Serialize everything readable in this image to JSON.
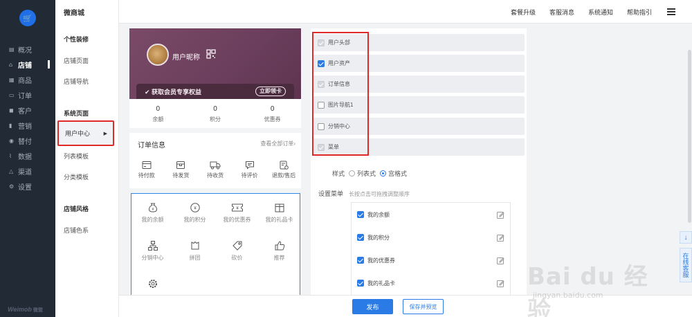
{
  "app": {
    "logo_glyph": "🛒",
    "brand": "Weimob",
    "brand_sub": "微盟"
  },
  "nav": {
    "items": [
      {
        "label": "概况",
        "icon": "▤"
      },
      {
        "label": "店铺",
        "icon": "⌂",
        "active": true
      },
      {
        "label": "商品",
        "icon": "▦"
      },
      {
        "label": "订单",
        "icon": "▭"
      },
      {
        "label": "客户",
        "icon": "◼"
      },
      {
        "label": "营销",
        "icon": "▮"
      },
      {
        "label": "替付",
        "icon": "◉"
      },
      {
        "label": "数据",
        "icon": "⌇"
      },
      {
        "label": "渠道",
        "icon": "△"
      },
      {
        "label": "设置",
        "icon": "⚙"
      }
    ]
  },
  "subnav": {
    "title": "微商城",
    "group1": "个性装修",
    "item_store_page": "店铺页面",
    "item_store_nav": "店铺导航",
    "group2": "系统页面",
    "item_user_center": "用户中心",
    "item_list_tpl": "列表模板",
    "item_cat_tpl": "分类模板",
    "group3": "店铺风格",
    "item_store_color": "店铺色系"
  },
  "topbar": {
    "links": [
      "套餐升级",
      "客服消息",
      "系统通知",
      "帮助指引"
    ]
  },
  "phone": {
    "nickname": "用户昵称",
    "vip_text": "获取会员专享权益",
    "vip_button": "立即领卡",
    "assets": [
      {
        "value": "0",
        "label": "余额"
      },
      {
        "value": "0",
        "label": "积分"
      },
      {
        "value": "0",
        "label": "优惠券"
      }
    ],
    "orders_title": "订单信息",
    "orders_link": "查看全部订单›",
    "order_items": [
      "待付款",
      "待发货",
      "待收货",
      "待评价",
      "退款/售后"
    ],
    "menu_items": [
      "我的余额",
      "我的积分",
      "我的优惠券",
      "我的礼品卡",
      "分销中心",
      "拼团",
      "砍价",
      "推荐",
      ""
    ]
  },
  "panel": {
    "modules": [
      {
        "label": "用户头部",
        "state": "disabled"
      },
      {
        "label": "用户资产",
        "state": "checked"
      },
      {
        "label": "订单信息",
        "state": "disabled"
      },
      {
        "label": "图片导航1",
        "state": "unchecked"
      },
      {
        "label": "分销中心",
        "state": "unchecked"
      },
      {
        "label": "菜单",
        "state": "disabled"
      }
    ],
    "style_label": "样式",
    "style_options": [
      "列表式",
      "宫格式"
    ],
    "style_selected": "宫格式",
    "set_menu_label": "设置菜单",
    "set_menu_hint": "长按点击可拖拽调整顺序",
    "menu_list": [
      "我的余额",
      "我的积分",
      "我的优惠券",
      "我的礼品卡"
    ]
  },
  "footer": {
    "publish": "发布",
    "save_preview": "保存并预览"
  },
  "right": {
    "back_top": "↓",
    "online_service": "在线客服"
  },
  "watermark": {
    "text": "Bai du 经验",
    "sub": "jingyan.baidu.com"
  },
  "colors": {
    "primary": "#2a7be6",
    "highlight_red": "#e02a2a",
    "sidebar_dark": "#222a36",
    "hero": "#6f4261"
  }
}
